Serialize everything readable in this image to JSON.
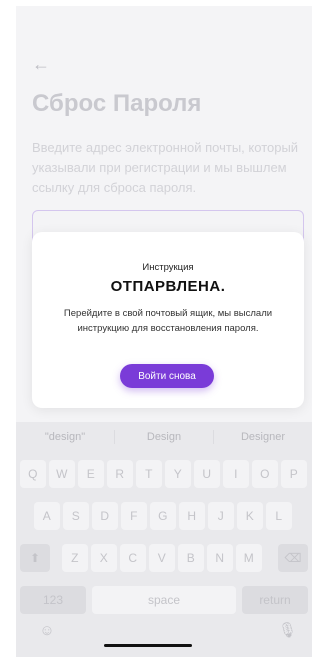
{
  "screen": {
    "title": "Сброс Пароля",
    "description": "Введите адрес электронной почты, который указывали при регистрации и мы вышлем ссылку для сброса пароля.",
    "back_icon": "arrow-left-icon"
  },
  "modal": {
    "label": "Инструкция",
    "title": "ОТПАРВЛЕНА.",
    "text": "Перейдите в свой почтовый ящик, мы выслали инструкцию для восстановления пароля.",
    "button": "Войти снова",
    "accent": "#7a3bd8"
  },
  "keyboard": {
    "suggestions": [
      "\"design\"",
      "Design",
      "Designer"
    ],
    "row1": [
      "Q",
      "W",
      "E",
      "R",
      "T",
      "Y",
      "U",
      "I",
      "O",
      "P"
    ],
    "row2": [
      "A",
      "S",
      "D",
      "F",
      "G",
      "H",
      "J",
      "K",
      "L"
    ],
    "row3": [
      "Z",
      "X",
      "C",
      "V",
      "B",
      "N",
      "M"
    ],
    "shift_icon": "shift-icon",
    "backspace_icon": "backspace-icon",
    "numbers": "123",
    "space": "space",
    "return": "return",
    "emoji_icon": "emoji-icon",
    "mic_icon": "microphone-icon"
  }
}
